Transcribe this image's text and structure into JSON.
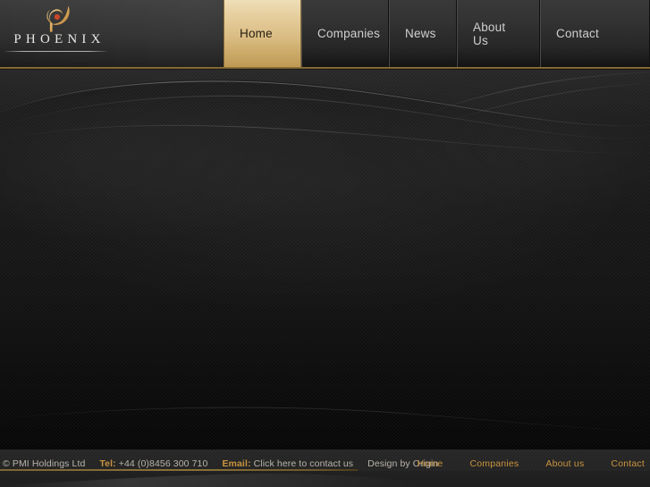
{
  "site": {
    "logo": {
      "wordmark": "PHOENIX",
      "mark_name": "phoenix-flame-icon",
      "gold": "#d8a24a",
      "accent_dot": "#c9462a"
    }
  },
  "header": {
    "nav": [
      {
        "label": "Home",
        "active": true,
        "name": "nav-item-home"
      },
      {
        "label": "Companies",
        "active": false,
        "name": "nav-item-companies"
      },
      {
        "label": "News",
        "active": false,
        "name": "nav-item-news"
      },
      {
        "label": "About Us",
        "active": false,
        "name": "nav-item-about-us"
      },
      {
        "label": "Contact",
        "active": false,
        "name": "nav-item-contact"
      }
    ],
    "active_tab_color": "#d9bb81",
    "rule_color": "#8a6f38"
  },
  "main": {
    "background_color": "#101010",
    "texture": "checkered-dot-pattern",
    "content": ""
  },
  "footer": {
    "copyright": "© PMI Holdings Ltd",
    "tel_label": "Tel:",
    "tel_value": "+44 (0)8456 300 710",
    "email_label": "Email:",
    "email_link": "Click here to contact us",
    "design_credit": "Design by Origin",
    "links": [
      {
        "label": "Home",
        "name": "footer-link-home"
      },
      {
        "label": "Companies",
        "name": "footer-link-companies"
      },
      {
        "label": "About us",
        "name": "footer-link-about-us"
      },
      {
        "label": "Contact",
        "name": "footer-link-contact"
      }
    ],
    "accent_color": "#c9943f",
    "text_color": "#b9b4ac"
  }
}
